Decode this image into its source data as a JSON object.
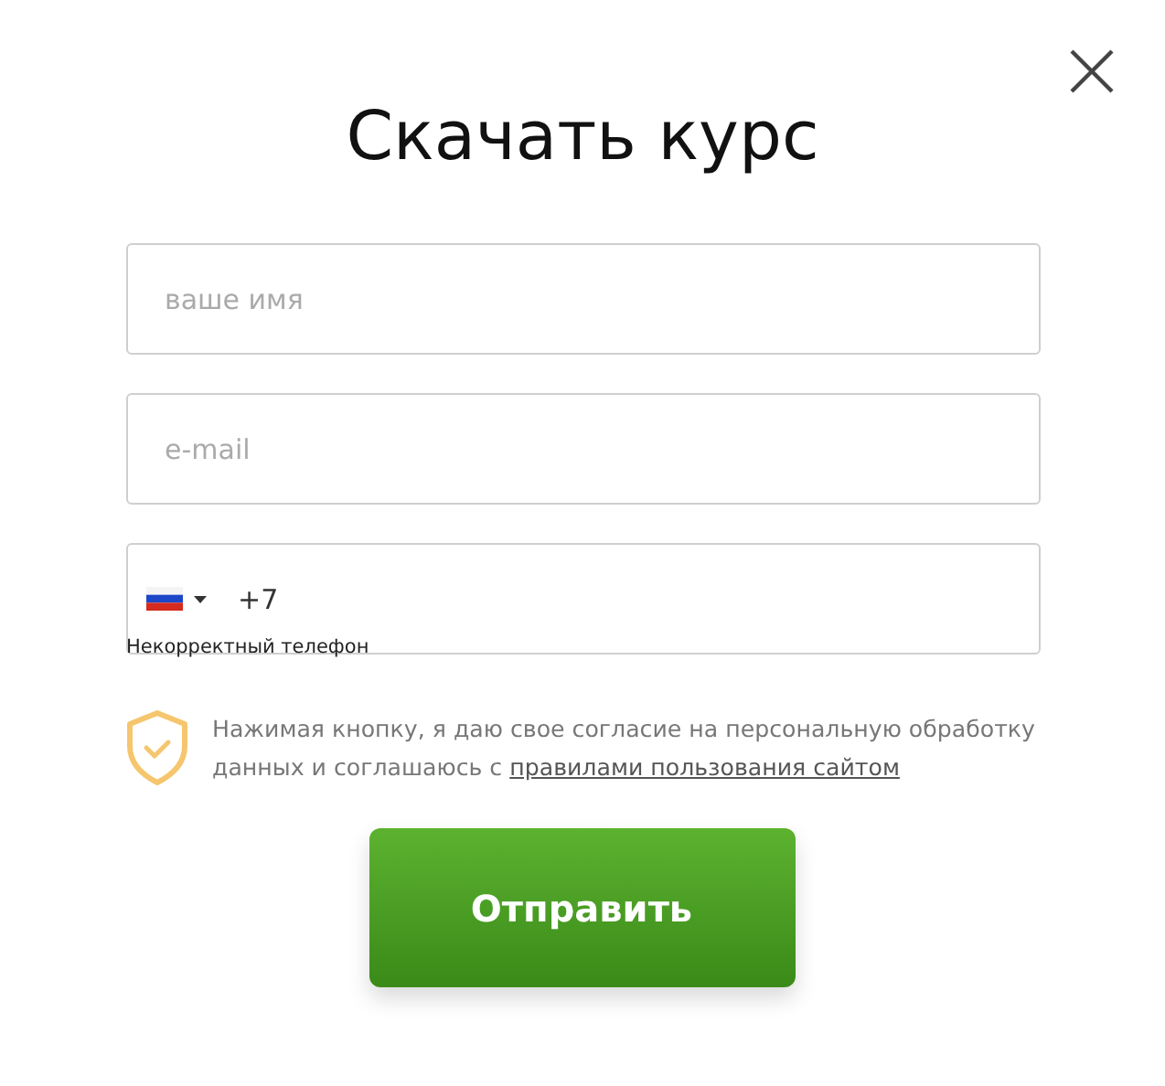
{
  "title": "Скачать курс",
  "fields": [
    {
      "kind": "text",
      "placeholder": "ваше имя"
    },
    {
      "kind": "text",
      "placeholder": "e-mail"
    },
    {
      "kind": "phone",
      "value": "+7",
      "error": "Некорректный телефон"
    }
  ],
  "consent": {
    "text": "Нажимая кнопку, я даю свое согласие на персональную обработку данных и соглашаюсь с",
    "link": "правилами пользования сайтом"
  },
  "submit": "Отправить"
}
